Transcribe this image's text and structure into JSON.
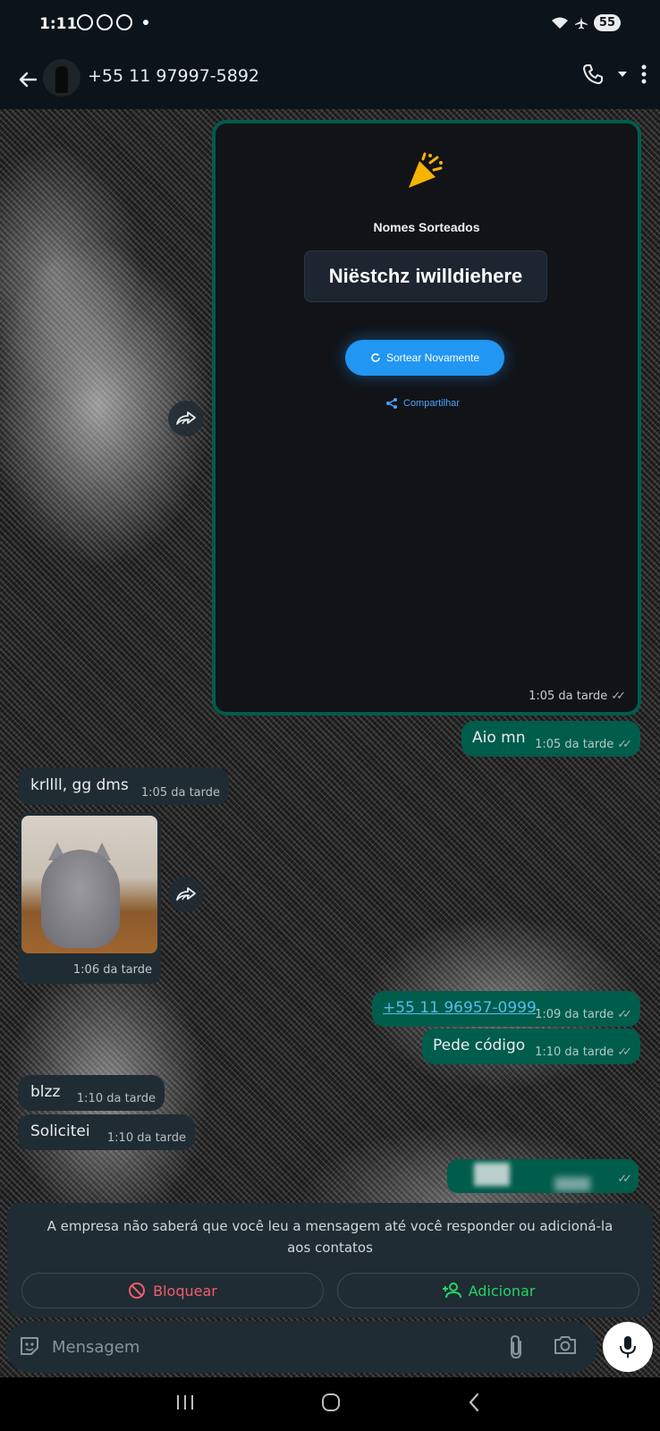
{
  "status_bar": {
    "time": "1:11",
    "battery": "55"
  },
  "header": {
    "contact": "+55 11 97997-5892"
  },
  "shared_screenshot": {
    "title": "Nomes Sorteados",
    "drawn_name": "Niëstchz iwilldiehere",
    "redraw_label": "Sortear Novamente",
    "share_label": "Compartilhar",
    "time": "1:05 da tarde"
  },
  "messages": [
    {
      "dir": "out",
      "text": "Aio mn",
      "time": "1:05 da tarde"
    },
    {
      "dir": "in",
      "text": "krllll, gg dms",
      "time": "1:05 da tarde"
    },
    {
      "dir": "in",
      "type": "image",
      "time": "1:06 da tarde"
    },
    {
      "dir": "out",
      "text": "+55 11 96957-0999",
      "time": "1:09 da tarde"
    },
    {
      "dir": "out",
      "text": "Pede código",
      "time": "1:10 da tarde"
    },
    {
      "dir": "in",
      "text": "blzz",
      "time": "1:10 da tarde"
    },
    {
      "dir": "in",
      "text": "Solicitei",
      "time": "1:10 da tarde"
    }
  ],
  "notice": {
    "text": "A empresa não saberá que você leu a mensagem até você responder ou adicioná-la aos contatos",
    "block_label": "Bloquear",
    "add_label": "Adicionar"
  },
  "composer": {
    "placeholder": "Mensagem"
  },
  "colors": {
    "outgoing": "#005c4b",
    "incoming": "#202c33",
    "accent": "#25d366",
    "danger": "#f15c6d"
  }
}
